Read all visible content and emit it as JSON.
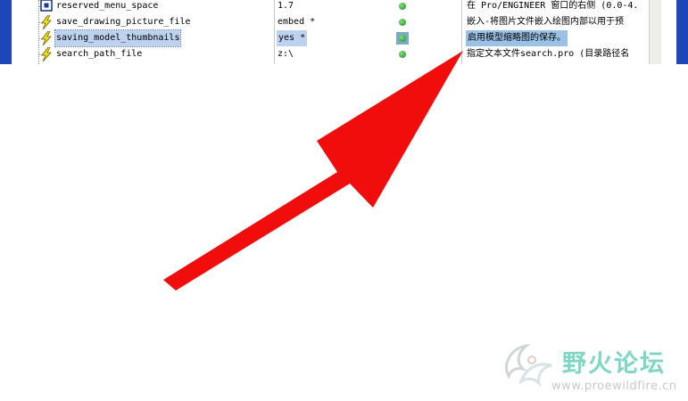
{
  "rows": [
    {
      "name": "reserved_menu_space",
      "value": "1.7",
      "description": "在 Pro/ENGINEER 窗口的右侧 (0.0-4.",
      "icon": "square-bullet-icon"
    },
    {
      "name": "save_drawing_picture_file",
      "value": "embed *",
      "description": "嵌入-将图片文件嵌入绘图内部以用于预",
      "icon": "lightning-icon"
    },
    {
      "name": "saving_model_thumbnails",
      "value": "yes *",
      "description": "启用模型缩略图的保存。",
      "icon": "lightning-icon",
      "selected": true
    },
    {
      "name": "search_path_file",
      "value": "z:\\",
      "description": "指定文本文件search.pro (目录路径名",
      "icon": "lightning-icon"
    }
  ],
  "status_dot_color": "#2e9e2e",
  "selection_color": "#bcd2ee",
  "arrow_color": "#f20d0d",
  "watermark": {
    "title": "野火论坛",
    "url": "www.proewildfire.cn"
  }
}
